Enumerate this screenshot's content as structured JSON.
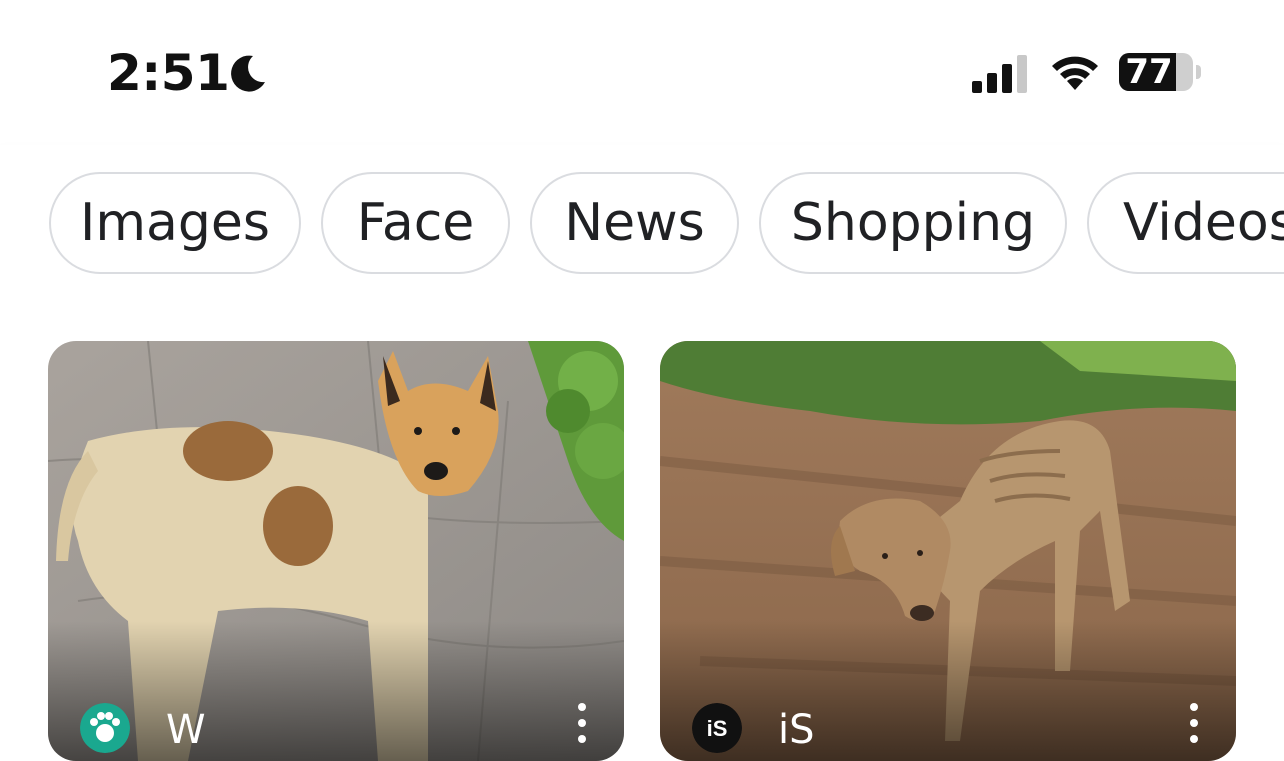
{
  "status_bar": {
    "time": "2:51",
    "focus_icon": "moon-icon",
    "signal_icon": "cellular-signal-icon",
    "wifi_icon": "wifi-icon",
    "battery_level": "77",
    "battery_fraction": 0.77
  },
  "chips": [
    {
      "label": "Images"
    },
    {
      "label": "Face"
    },
    {
      "label": "News"
    },
    {
      "label": "Shopping"
    },
    {
      "label": "Videos"
    }
  ],
  "results": [
    {
      "source": "W",
      "icon": "paw-icon",
      "icon_color": "#1aa88f",
      "photo": "stray-dog-on-pavement"
    },
    {
      "source": "iS",
      "icon": "istock-icon",
      "icon_color": "#111111",
      "photo": "thin-dog-on-dirt-path"
    }
  ],
  "colors": {
    "chip_border": "#dadce0",
    "chip_text": "#202124"
  }
}
